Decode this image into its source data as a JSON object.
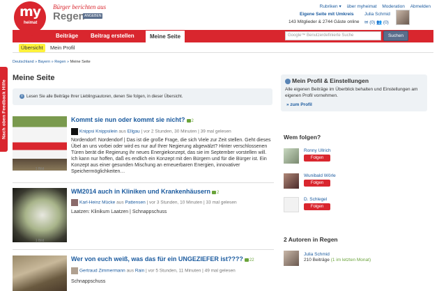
{
  "feedback_tab": "Nach oben  Feedback  Hilfe",
  "header": {
    "logo_my": "my",
    "logo_heimat": "heimat",
    "slogan": "Bürger berichten aus",
    "region": "Regen",
    "region_badge": "ANGEBEN"
  },
  "toplinks": [
    "Rubriken ▾",
    "über myheimat",
    "Moderation",
    "Abmelden"
  ],
  "account": {
    "own_page": "Eigene Seite mit Umkreis",
    "members": "143 Mitglieder & 2744 Gäste online",
    "user_name": "Julia Schmid",
    "user_counts": "✉ (0)  👥 (0)"
  },
  "nav": {
    "tabs": [
      "Beiträge",
      "Beitrag erstellen",
      "Meine Seite"
    ],
    "active": "Meine Seite",
    "search_placeholder": "Google™ Benutzerdefinierte Suche",
    "search_button": "Suchen"
  },
  "subnav": {
    "tabs": [
      "Übersicht",
      "Mein Profil"
    ]
  },
  "breadcrumb": [
    "Deutschland",
    "Bayern",
    "Regen",
    "Meine Seite"
  ],
  "page_title": "Meine Seite",
  "info_text": "Lesen Sie alle Beiträge Ihrer Lieblingsautoren, denen Sie folgen, in dieser Übersicht.",
  "articles": [
    {
      "title": "Kommt sie nun oder kommt sie nicht?",
      "comments": "2",
      "author": "Knippsi Knippsilein",
      "meta_prefix": "aus",
      "place": "Ellgau",
      "meta_suffix": "| vor 2 Stunden, 30 Minuten | 39 mal gelesen",
      "excerpt": "Nordendorf: Nordendorf | Das ist die große Frage, die sich Viele zur Zeit stellen. Geht dieses Übel an uns vorbei oder wird es nur auf Ihrer Negierung abgewälzt? Hinter verschlossenen Türen berät die Regierung ihr neues Energiekonzept, das sie im September vorstellen will. Ich kann nur hoffen, daß es endlich ein Konzept mit den Bürgern und für die Bürger ist. Ein Konzept aus einer gesunden Mischung an erneuerbaren Energien, innovativer Speichermöglichkeiten…",
      "image_caption": "1 Bild"
    },
    {
      "title": "WM2014 auch in Kliniken und Krankenhäusern",
      "comments": "2",
      "author": "Karl-Heinz Mücke",
      "meta_prefix": "aus",
      "place": "Pattensen",
      "meta_suffix": "| vor 3 Stunden, 10 Minuten | 33 mal gelesen",
      "excerpt": "Laatzen: Klinikum Laatzen | Schnappschuss",
      "image_caption": "1 Bild"
    },
    {
      "title": "Wer von euch weiß, was das für ein UNGEZIEFER ist????",
      "comments": "22",
      "author": "Gertraud Zimmermann",
      "meta_prefix": "aus",
      "place": "Rain",
      "meta_suffix": "| vor 5 Stunden, 11 Minuten | 49 mal gelesen",
      "excerpt": "Schnappschuss",
      "image_caption": ""
    }
  ],
  "profile_box": {
    "heading": "Mein Profil & Einstellungen",
    "text": "Alle eigenen Beiträge im Überblick behalten und Einstellungen am eigenen Profil vornehmen.",
    "link": "» zum Profil"
  },
  "following": {
    "heading": "Wem folgen?",
    "button": "Folgen",
    "people": [
      "Ronny Ullrich",
      "Wunibald Wörle",
      "D. Schlegel"
    ]
  },
  "authors": {
    "heading": "2 Autoren in Regen",
    "name": "Julia Schmid",
    "count": "210 Beiträge",
    "recent": "(1 im letzten Monat)"
  },
  "colors": {
    "brand_red": "#d9262e",
    "link_blue": "#1a5a9e",
    "subnav_highlight": "#fff23a"
  }
}
